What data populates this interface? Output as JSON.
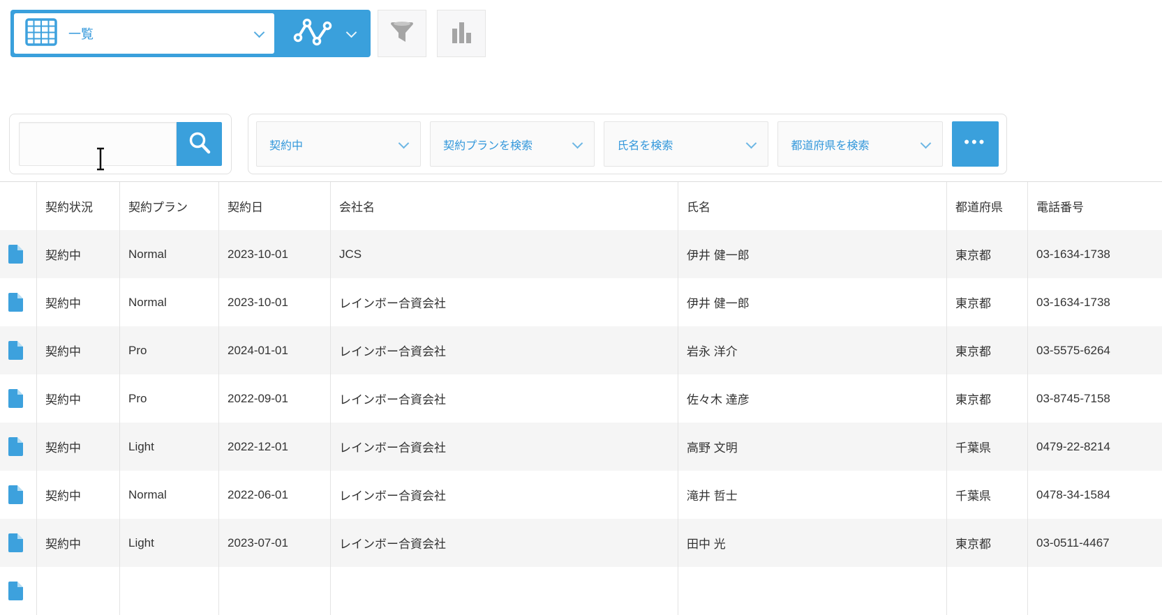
{
  "colors": {
    "accent_blue": "#3aa0dc",
    "link_blue": "#3498db",
    "row_alt_bg": "#f5f5f5",
    "border_gray": "#e3e3e3",
    "icon_gray": "#a5a5a5"
  },
  "toolbar": {
    "view_selector_value": "一覧"
  },
  "search": {
    "value": "",
    "placeholder": ""
  },
  "filters": {
    "status_value": "契約中",
    "plan_placeholder": "契約プランを検索",
    "name_placeholder": "氏名を検索",
    "prefecture_placeholder": "都道府県を検索",
    "more_label": "•••"
  },
  "table": {
    "columns": [
      "契約状況",
      "契約プラン",
      "契約日",
      "会社名",
      "氏名",
      "都道府県",
      "電話番号"
    ],
    "rows": [
      [
        "契約中",
        "Normal",
        "2023-10-01",
        "JCS",
        "伊井 健一郎",
        "東京都",
        "03-1634-1738"
      ],
      [
        "契約中",
        "Normal",
        "2023-10-01",
        "レインボー合資会社",
        "伊井 健一郎",
        "東京都",
        "03-1634-1738"
      ],
      [
        "契約中",
        "Pro",
        "2024-01-01",
        "レインボー合資会社",
        "岩永 洋介",
        "東京都",
        "03-5575-6264"
      ],
      [
        "契約中",
        "Pro",
        "2022-09-01",
        "レインボー合資会社",
        "佐々木 達彦",
        "東京都",
        "03-8745-7158"
      ],
      [
        "契約中",
        "Light",
        "2022-12-01",
        "レインボー合資会社",
        "高野 文明",
        "千葉県",
        "0479-22-8214"
      ],
      [
        "契約中",
        "Normal",
        "2022-06-01",
        "レインボー合資会社",
        "滝井 哲士",
        "千葉県",
        "0478-34-1584"
      ],
      [
        "契約中",
        "Light",
        "2023-07-01",
        "レインボー合資会社",
        "田中 光",
        "東京都",
        "03-0511-4467"
      ],
      [
        "",
        "",
        "",
        "",
        "",
        "",
        ""
      ]
    ]
  }
}
